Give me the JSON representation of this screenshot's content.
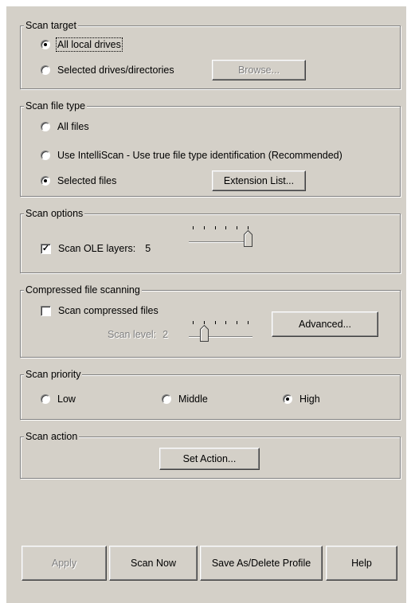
{
  "scan_target": {
    "legend": "Scan target",
    "options": [
      "All local drives",
      "Selected drives/directories"
    ],
    "browse_label": "Browse..."
  },
  "scan_file_type": {
    "legend": "Scan file type",
    "options": [
      "All files",
      "Use IntelliScan - Use true file type identification (Recommended)",
      "Selected files"
    ],
    "extension_list_label": "Extension List..."
  },
  "scan_options": {
    "legend": "Scan options",
    "ole_label": "Scan OLE layers:",
    "ole_value": "5",
    "ole_slider_level": 5,
    "ole_slider_max": 5
  },
  "compressed": {
    "legend": "Compressed file scanning",
    "checkbox_label": "Scan compressed files",
    "scan_level_label": "Scan level:",
    "scan_level_value": "2",
    "slider_level": 1,
    "slider_max": 5,
    "advanced_label": "Advanced..."
  },
  "scan_priority": {
    "legend": "Scan priority",
    "options": [
      "Low",
      "Middle",
      "High"
    ]
  },
  "scan_action": {
    "legend": "Scan action",
    "set_action_label": "Set Action..."
  },
  "footer": {
    "apply_label": "Apply",
    "scan_now_label": "Scan Now",
    "save_profile_label": "Save As/Delete Profile",
    "help_label": "Help"
  }
}
